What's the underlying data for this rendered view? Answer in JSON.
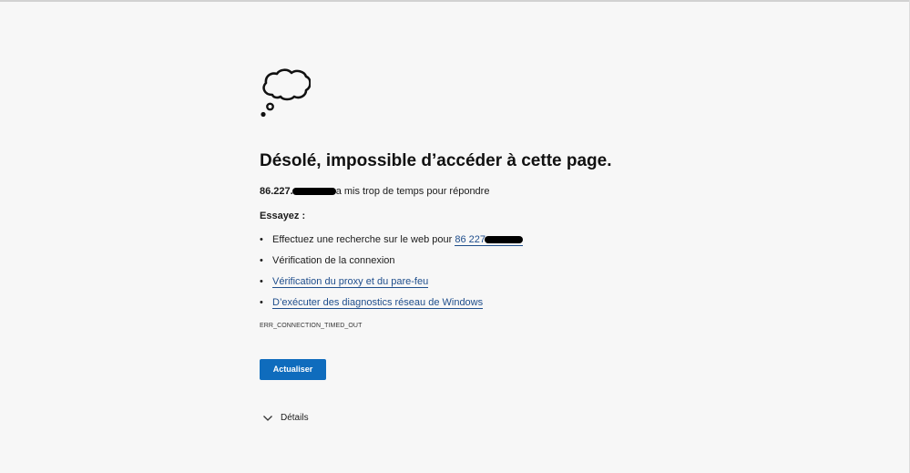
{
  "error_page": {
    "title": "Désolé, impossible d’accéder à cette page.",
    "host_visible": "86.227.",
    "message_suffix": "a mis trop de temps pour répondre",
    "try_heading": "Essayez :",
    "suggestions": [
      {
        "text": "Effectuez une recherche sur le web pour ",
        "link": "86 227",
        "is_link": false
      },
      {
        "text": "Vérification de la connexion",
        "is_link": false
      },
      {
        "text": "Vérification du proxy et du pare-feu",
        "is_link": true
      },
      {
        "text": "D’exécuter des diagnostics réseau de Windows",
        "is_link": true
      }
    ],
    "error_code": "ERR_CONNECTION_TIMED_OUT",
    "refresh_label": "Actualiser",
    "details_label": "Détails"
  },
  "colors": {
    "background": "#f7f7f7",
    "link": "#1f4e8c",
    "button": "#0f6cbd"
  },
  "icons": {
    "illustration": "thought-cloud-icon",
    "details_toggle": "chevron-down-icon"
  }
}
